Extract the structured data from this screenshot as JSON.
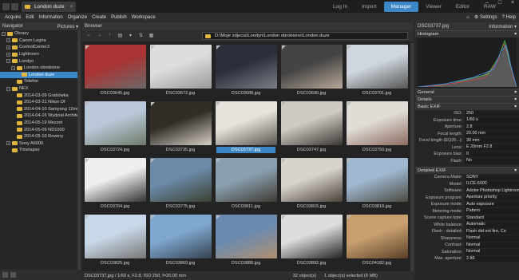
{
  "window": {
    "tab_title": "London duze",
    "modes": [
      "Log In",
      "Import",
      "Manager",
      "Viewer",
      "Editor",
      "RAW"
    ],
    "active_mode": "Manager"
  },
  "menu": {
    "items": [
      "Acquire",
      "Edit",
      "Information",
      "Organize",
      "Create",
      "Publish",
      "Workspace"
    ],
    "settings": "Settings",
    "help": "Help"
  },
  "navigator": {
    "title": "Navigator",
    "pictures_label": "Pictures ▾",
    "tree": [
      {
        "label": "Obrazy",
        "level": 0,
        "tw": "−"
      },
      {
        "label": "Canon Legria",
        "level": 1,
        "tw": "+"
      },
      {
        "label": "ControlCenter3",
        "level": 1,
        "tw": "+"
      },
      {
        "label": "Lightroom",
        "level": 1,
        "tw": "+"
      },
      {
        "label": "Londyn",
        "level": 1,
        "tw": "−"
      },
      {
        "label": "London obrobione",
        "level": 2,
        "tw": "−"
      },
      {
        "label": "London duze",
        "level": 3,
        "tw": "",
        "selected": true
      },
      {
        "label": "Telefon",
        "level": 2,
        "tw": ""
      },
      {
        "label": "NEX",
        "level": 1,
        "tw": "−"
      },
      {
        "label": "2014-03-09 Grabówka",
        "level": 2,
        "tw": ""
      },
      {
        "label": "2014-03-21 Nikon Df",
        "level": 2,
        "tw": ""
      },
      {
        "label": "2014-04-10 Samyang 12mm",
        "level": 2,
        "tw": ""
      },
      {
        "label": "2014-04-16 Wydział Architekt",
        "level": 2,
        "tw": ""
      },
      {
        "label": "2014-05-19 Mezzet",
        "level": 2,
        "tw": ""
      },
      {
        "label": "2014-05-09 ND1000",
        "level": 2,
        "tw": ""
      },
      {
        "label": "2014-05-10 Rowery",
        "level": 2,
        "tw": ""
      },
      {
        "label": "Sony A6000",
        "level": 1,
        "tw": "+"
      },
      {
        "label": "Timelapse",
        "level": 1,
        "tw": ""
      }
    ]
  },
  "browser": {
    "title": "Browser",
    "path": "D:\\Moje zdjecia\\Londyn\\London obrobione\\London duze",
    "files": [
      {
        "name": "DSC03645.jpg",
        "c1": "#a33",
        "c2": "#6a6a6a"
      },
      {
        "name": "DSC03672.jpg",
        "c1": "#ddd",
        "c2": "#999"
      },
      {
        "name": "DSC03688.jpg",
        "c1": "#2a2f3a",
        "c2": "#7a7f88"
      },
      {
        "name": "DSC03690.jpg",
        "c1": "#444",
        "c2": "#b9a898"
      },
      {
        "name": "DSC03701.jpg",
        "c1": "#cfd6de",
        "c2": "#555"
      },
      {
        "name": "DSC03724.jpg",
        "c1": "#b9c7d8",
        "c2": "#6e7a68"
      },
      {
        "name": "DSC03735.jpg",
        "c1": "#332d28",
        "c2": "#d6d0c8"
      },
      {
        "name": "DSC03737.jpg",
        "c1": "#e7e3dc",
        "c2": "#5a5550",
        "selected": true
      },
      {
        "name": "DSC03747.jpg",
        "c1": "#cfcac2",
        "c2": "#3a3632"
      },
      {
        "name": "DSC03750.jpg",
        "c1": "#e0dcd6",
        "c2": "#8a6a60"
      },
      {
        "name": "DSC03764.jpg",
        "c1": "#eee",
        "c2": "#333"
      },
      {
        "name": "DSC03775.jpg",
        "c1": "#6c8aa8",
        "c2": "#3a4030"
      },
      {
        "name": "DSC03811.jpg",
        "c1": "#8aa0b0",
        "c2": "#3f3a32"
      },
      {
        "name": "DSC03815.jpg",
        "c1": "#d8d4cc",
        "c2": "#4a4038"
      },
      {
        "name": "DSC03818.jpg",
        "c1": "#9fb7cf",
        "c2": "#4a4a40"
      },
      {
        "name": "DSC03825.jpg",
        "c1": "#c9d8e8",
        "c2": "#777"
      },
      {
        "name": "DSC03869.jpg",
        "c1": "#7fa7cf",
        "c2": "#36424f"
      },
      {
        "name": "DSC03888.jpg",
        "c1": "#6a8ab0",
        "c2": "#b09070"
      },
      {
        "name": "DSC03892.jpg",
        "c1": "#ddd",
        "c2": "#222"
      },
      {
        "name": "DSC04182.jpg",
        "c1": "#c8a070",
        "c2": "#5a4028"
      }
    ]
  },
  "status": {
    "left": "DSC03737.jpg / 1/60 s, F2.8, ISO 250, f=20.00 mm",
    "middle": "32 object(s)",
    "right": "1 object(s) selected (6 MB)"
  },
  "info": {
    "title": "DSC03737.jpg",
    "info_label": "Information ▾",
    "histogram": "Histogram",
    "general": "General",
    "details": "Details",
    "basic_exif": "Basic EXIF",
    "basic": [
      {
        "k": "ISO:",
        "v": "250"
      },
      {
        "k": "Exposure time:",
        "v": "1/60 s"
      },
      {
        "k": "Aperture:",
        "v": "2.8"
      },
      {
        "k": "Focal length:",
        "v": "20.00 mm"
      },
      {
        "k": "Focal length (EQ35...):",
        "v": "30 mm"
      },
      {
        "k": "Lens:",
        "v": "E 20mm F2.8"
      },
      {
        "k": "Exposure bias:",
        "v": "0"
      },
      {
        "k": "Flash:",
        "v": "No"
      }
    ],
    "detailed_exif": "Detailed EXIF",
    "detailed": [
      {
        "k": "Camera Make:",
        "v": "SONY"
      },
      {
        "k": "Model:",
        "v": "ILCE-6000"
      },
      {
        "k": "Software:",
        "v": "Adobe Photoshop Lightroom"
      },
      {
        "k": "Exposure program:",
        "v": "Aperture priority"
      },
      {
        "k": "Exposure mode:",
        "v": "Auto exposure"
      },
      {
        "k": "Metering mode:",
        "v": "Pattern"
      },
      {
        "k": "Scene capture type:",
        "v": "Standard"
      },
      {
        "k": "White balance:",
        "v": "Automatic"
      },
      {
        "k": "Flash - detailed:",
        "v": "Flash did not fire, Co"
      },
      {
        "k": "Sharpness:",
        "v": "Normal"
      },
      {
        "k": "Contrast:",
        "v": "Normal"
      },
      {
        "k": "Saturation:",
        "v": "Normal"
      },
      {
        "k": "Max. aperture:",
        "v": "2.86"
      }
    ]
  },
  "colors": {
    "accent": "#3c87c8",
    "folder": "#e0b53a"
  }
}
